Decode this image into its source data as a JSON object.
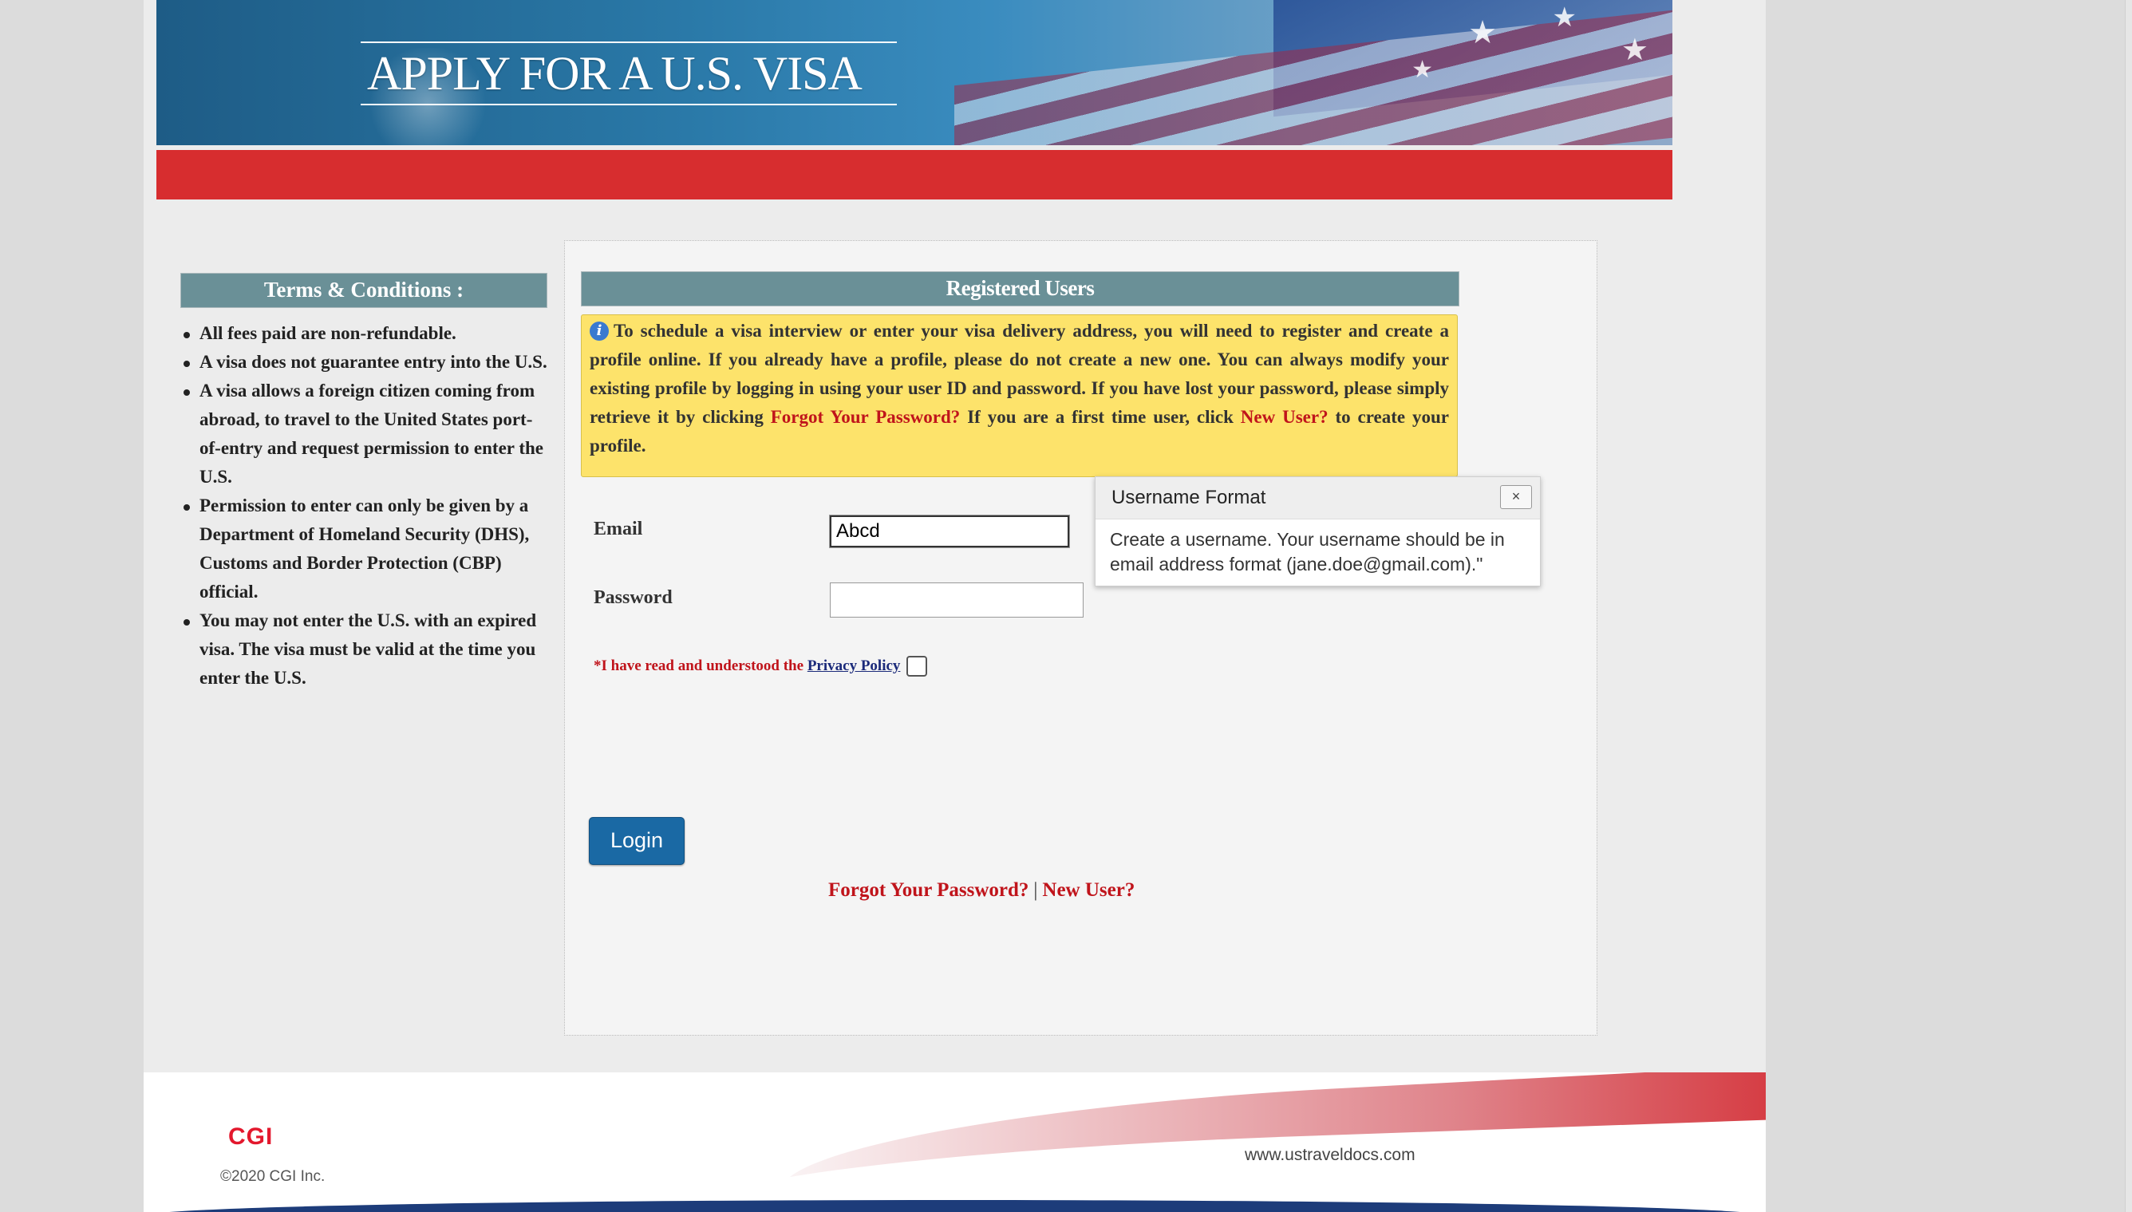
{
  "header": {
    "title": "APPLY FOR A U.S. VISA"
  },
  "terms": {
    "heading": "Terms & Conditions :",
    "items": [
      "All fees paid are non-refundable.",
      "A visa does not guarantee entry into the U.S.",
      "A visa allows a foreign citizen coming from abroad, to travel to the United States port-of-entry and request permission to enter the U.S.",
      "Permission to enter can only be given by a Department of Homeland Security (DHS), Customs and Border Protection (CBP) official.",
      "You may not enter the U.S. with an expired visa. The visa must be valid at the time you enter the U.S."
    ]
  },
  "login": {
    "heading": "Registered Users",
    "info": {
      "text_1": "To schedule a visa interview or enter your visa delivery address, you will need to register and create a profile online. If you already have a profile, please do not create a new one. You can always modify your existing profile by logging in using your user ID and password. If you have lost your password, please simply retrieve it by clicking ",
      "forgot_link": "Forgot Your Password?",
      "text_2": " If you are a first time user, click ",
      "new_user_link": "New User?",
      "text_3": " to create your profile."
    },
    "email_label": "Email",
    "email_value": "Abcd",
    "password_label": "Password",
    "password_value": "",
    "privacy_text": "*I have read and understood the ",
    "privacy_link": "Privacy Policy",
    "login_button": "Login",
    "forgot_link": "Forgot Your Password?",
    "separator": "|",
    "new_user_link": "New User?"
  },
  "tooltip": {
    "title": "Username Format",
    "close": "×",
    "body": "Create a username. Your username should be in email address format (jane.doe@gmail.com).\""
  },
  "footer": {
    "logo": "CGI",
    "copyright": "©2020 CGI Inc.",
    "url": "www.ustraveldocs.com"
  },
  "colors": {
    "header_red": "#d72d2f",
    "heading_teal": "#6a9097",
    "info_yellow": "#fde36b",
    "link_red": "#c0141b",
    "button_blue": "#1a69a4",
    "cgi_red": "#e3182d"
  },
  "icons": [
    "info-icon",
    "close-icon"
  ]
}
